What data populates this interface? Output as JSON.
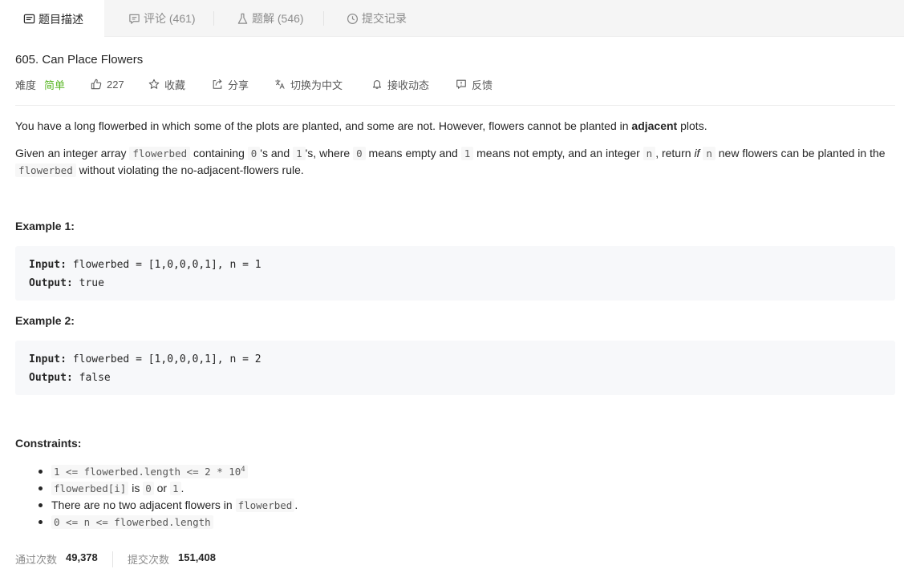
{
  "tabs": [
    {
      "label": "题目描述",
      "icon": "description-icon"
    },
    {
      "label": "评论 (461)",
      "icon": "comment-icon"
    },
    {
      "label": "题解 (546)",
      "icon": "flask-icon"
    },
    {
      "label": "提交记录",
      "icon": "clock-icon"
    }
  ],
  "problem": {
    "title": "605. Can Place Flowers",
    "difficulty_label": "难度",
    "difficulty": "简单",
    "likes": "227",
    "favorite": "收藏",
    "share": "分享",
    "translate": "切换为中文",
    "notify": "接收动态",
    "feedback": "反馈"
  },
  "description": {
    "p1_pre": "You have a long flowerbed in which some of the plots are planted, and some are not. However, flowers cannot be planted in ",
    "p1_bold": "adjacent",
    "p1_post": " plots.",
    "p2": {
      "t1": "Given an integer array ",
      "c1": "flowerbed",
      "t2": " containing ",
      "c2": "0",
      "t3": "'s and ",
      "c3": "1",
      "t4": "'s, where ",
      "c4": "0",
      "t5": " means empty and ",
      "c5": "1",
      "t6": " means not empty, and an integer ",
      "c6": "n",
      "t7": ", return ",
      "i1": "if",
      "c7": "n",
      "t8": " new flowers can be planted in the ",
      "c8": "flowerbed",
      "t9": " without violating the no-adjacent-flowers rule."
    }
  },
  "examples": [
    {
      "heading": "Example 1:",
      "input_label": "Input:",
      "input": "flowerbed = [1,0,0,0,1], n = 1",
      "output_label": "Output:",
      "output": "true"
    },
    {
      "heading": "Example 2:",
      "input_label": "Input:",
      "input": "flowerbed = [1,0,0,0,1], n = 2",
      "output_label": "Output:",
      "output": "false"
    }
  ],
  "constraints": {
    "heading": "Constraints:",
    "c1": {
      "code": "1 <= flowerbed.length <= 2 * 10",
      "sup": "4"
    },
    "c2": {
      "code1": "flowerbed[i]",
      "t1": " is ",
      "code2": "0",
      "t2": " or ",
      "code3": "1",
      "t3": "."
    },
    "c3": {
      "t1": "There are no two adjacent flowers in ",
      "code": "flowerbed",
      "t2": "."
    },
    "c4": {
      "code": "0 <= n <= flowerbed.length"
    }
  },
  "stats": {
    "accepted_label": "通过次数",
    "accepted": "49,378",
    "submitted_label": "提交次数",
    "submitted": "151,408"
  }
}
